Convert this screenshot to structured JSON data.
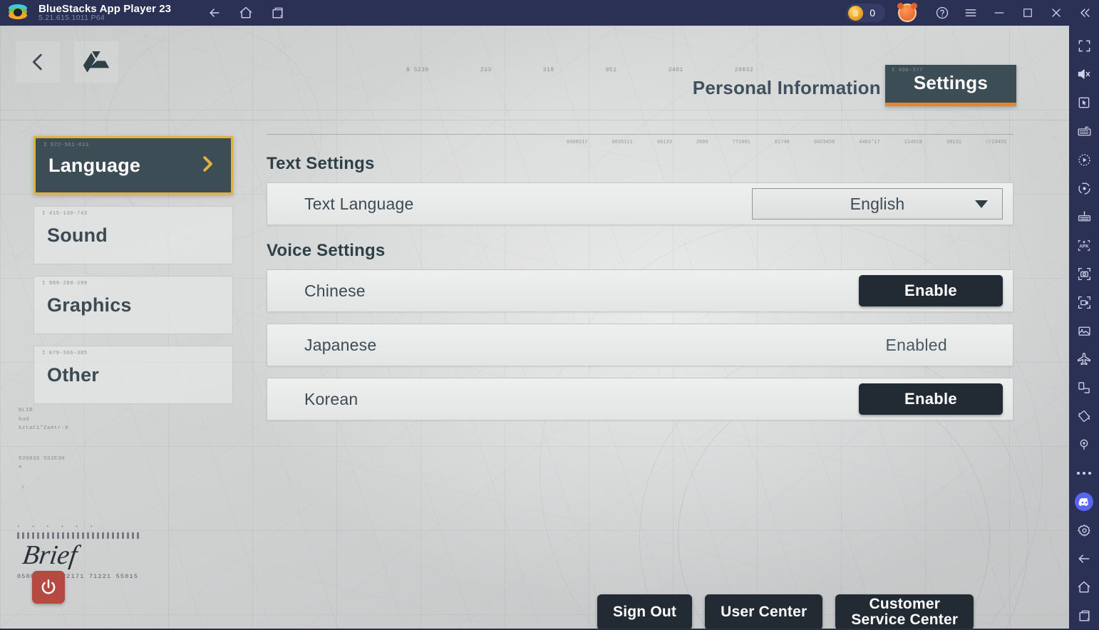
{
  "titlebar": {
    "app_name": "BlueStacks App Player 23",
    "version": "5.21.615.1011  P64",
    "logo_icon": "bluestacks-logo",
    "nav": [
      {
        "icon": "back-arrow-icon"
      },
      {
        "icon": "home-icon"
      },
      {
        "icon": "multi-instance-icon"
      }
    ],
    "coin_count": "0",
    "coin_icon": "coin-icon",
    "avatar_icon": "bear-avatar-icon",
    "help_icon": "help-circle-icon",
    "menu_icon": "hamburger-menu-icon",
    "minimize_icon": "minimize-icon",
    "maximize_icon": "maximize-icon",
    "close_icon": "close-icon",
    "collapse_icon": "collapse-chevrons-icon"
  },
  "rail": {
    "items": [
      {
        "icon": "fullscreen-icon"
      },
      {
        "icon": "mute-speaker-icon"
      },
      {
        "icon": "cursor-pointer-icon"
      },
      {
        "icon": "keyboard-controls-icon"
      },
      {
        "icon": "macro-play-icon"
      },
      {
        "icon": "eco-mode-icon"
      },
      {
        "icon": "multi-instance-manager-icon"
      },
      {
        "icon": "install-apk-icon"
      },
      {
        "icon": "screenshot-camera-icon"
      },
      {
        "icon": "record-video-icon"
      },
      {
        "icon": "media-manager-icon"
      },
      {
        "icon": "airplane-mode-icon"
      },
      {
        "icon": "rotate-screen-icon"
      },
      {
        "icon": "shake-device-icon"
      },
      {
        "icon": "location-pin-icon"
      },
      {
        "icon": "more-dots-icon"
      },
      {
        "icon": "discord-icon"
      },
      {
        "icon": "gear-settings-icon"
      },
      {
        "icon": "back-arrow-icon"
      },
      {
        "icon": "home-icon"
      },
      {
        "icon": "recent-apps-icon"
      }
    ]
  },
  "game": {
    "topleft": {
      "back_icon": "back-chevron-icon",
      "drive_icon": "google-drive-icon"
    },
    "header": {
      "inactive_tab": "Personal Information",
      "active_tab": "Settings",
      "active_tab_code": "I 496-377"
    },
    "sidebar": {
      "items": [
        {
          "label": "Language",
          "code": "I 972-561-613",
          "active": true,
          "chevron_icon": "chevron-right-icon"
        },
        {
          "label": "Sound",
          "code": "I 415-130-743",
          "active": false
        },
        {
          "label": "Graphics",
          "code": "I 989-280-299",
          "active": false
        },
        {
          "label": "Other",
          "code": "I 879-366-385",
          "active": false
        }
      ]
    },
    "decor": {
      "dots": "• • • • • •",
      "signature": "Brief",
      "serial": "0500411  0822171  71221  55015",
      "misc_1": "NLIB",
      "misc_2": "hud",
      "misc_3": "kztaC1*Zaetr-8",
      "misc_4": "820036  5S3E3H",
      "misc_5": "≡",
      "misc_6": "/"
    },
    "power_icon": "power-button-icon",
    "text_settings": {
      "title": "Text Settings",
      "row_label": "Text Language",
      "selected_value": "English",
      "caret_icon": "chevron-down-icon"
    },
    "voice_settings": {
      "title": "Voice Settings",
      "rows": [
        {
          "label": "Chinese",
          "action": "Enable",
          "is_button": true
        },
        {
          "label": "Japanese",
          "action": "Enabled",
          "is_button": false
        },
        {
          "label": "Korean",
          "action": "Enable",
          "is_button": true
        }
      ]
    },
    "bottom_buttons": [
      {
        "label": "Sign Out"
      },
      {
        "label": "User Center"
      },
      {
        "label": "Customer\nService Center"
      }
    ],
    "map_ticks": [
      "8   5230",
      "233",
      "318",
      "951",
      "3401",
      "29832"
    ],
    "map_ticks2": [
      "0308317",
      "0035111",
      "99133",
      "2609",
      "771081",
      "01749",
      "6023456",
      "4463'17",
      "114518",
      "39131",
      "//23455"
    ]
  },
  "colors": {
    "accent_orange": "#e8852c",
    "accent_gold": "#e0b43c",
    "dark_slate": "#3d4d55",
    "button_dark": "#222b33",
    "titlebar_navy": "#2b3055",
    "power_red": "#b44a42"
  }
}
